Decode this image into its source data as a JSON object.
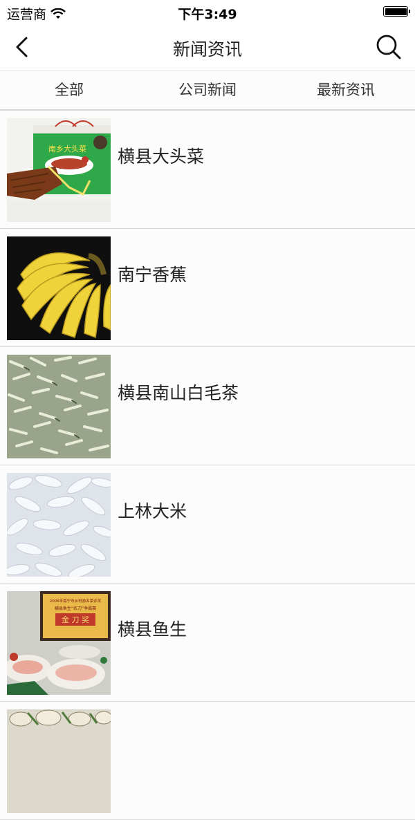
{
  "status_bar": {
    "carrier": "运营商",
    "time": "下午3:49",
    "wifi_icon": "wifi-icon",
    "battery_icon": "battery-icon"
  },
  "nav": {
    "title": "新闻资讯",
    "back_icon": "chevron-left-icon",
    "search_icon": "search-icon"
  },
  "tabs": [
    {
      "label": "全部"
    },
    {
      "label": "公司新闻"
    },
    {
      "label": "最新资讯"
    }
  ],
  "items": [
    {
      "title": "横县大头菜"
    },
    {
      "title": "南宁香蕉"
    },
    {
      "title": "横县南山白毛茶"
    },
    {
      "title": "上林大米"
    },
    {
      "title": "横县鱼生"
    },
    {
      "title": ""
    }
  ],
  "thumb_text": {
    "cabbage_box": "南乡大头菜",
    "fish_plaque_line1": "2006年南宁市乡村游名菜评奖",
    "fish_plaque_line2": "横县鱼生“名刀”争霸赛",
    "fish_plaque_award": "金 刀 奖"
  },
  "colors": {
    "text": "#222222",
    "divider": "#d9d9d9",
    "background": "#ffffff"
  }
}
